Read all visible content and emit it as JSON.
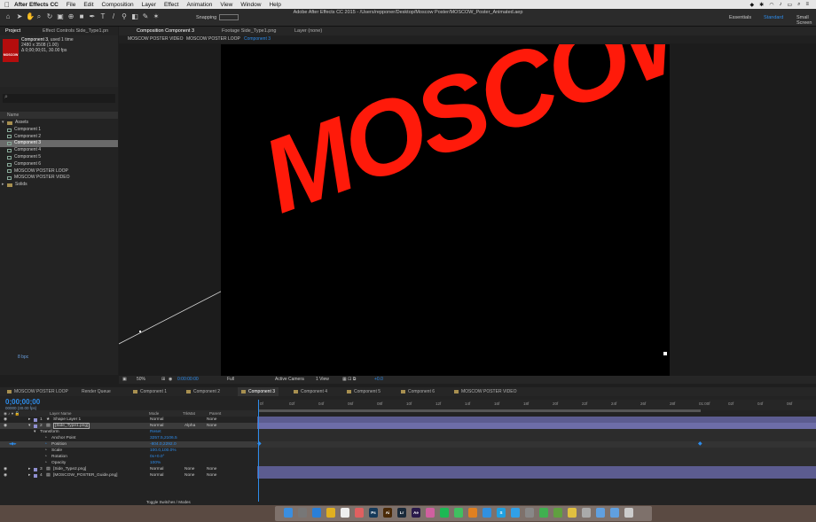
{
  "menubar": {
    "apple": "",
    "app": "After Effects CC",
    "items": [
      "File",
      "Edit",
      "Composition",
      "Layer",
      "Effect",
      "Animation",
      "View",
      "Window",
      "Help"
    ]
  },
  "window_title": "Adobe After Effects CC 2015 - /Users/repponer/Desktop/Moscow Poster/MOSCOW_Poster_Animated.aep",
  "toolbar": {
    "snapping": "Snapping",
    "workspaces": [
      "Essentials",
      "Standard",
      "Small Screen"
    ],
    "active_workspace": "Standard"
  },
  "project": {
    "tabs": [
      "Project",
      "Effect Controls Side_Type1.pn"
    ],
    "thumb_label": "MOSCOW",
    "selected_name": "Component 3",
    "used": ", used 1 time",
    "size": "2480 x 3508 (1.00)",
    "duration": "Δ 0;00;00;01, 30.00 fps",
    "search_icon": "⌕",
    "col_name": "Name",
    "items": [
      {
        "label": "Assets",
        "type": "folder"
      },
      {
        "label": "Component 1",
        "type": "comp"
      },
      {
        "label": "Component 2",
        "type": "comp"
      },
      {
        "label": "Component 3",
        "type": "comp"
      },
      {
        "label": "Component 4",
        "type": "comp"
      },
      {
        "label": "Component 5",
        "type": "comp"
      },
      {
        "label": "Component 6",
        "type": "comp"
      },
      {
        "label": "MOSCOW POSTER LOOP",
        "type": "comp"
      },
      {
        "label": "MOSCOW POSTER VIDEO",
        "type": "comp"
      },
      {
        "label": "Solids",
        "type": "folder"
      }
    ],
    "bpc": "8 bpc"
  },
  "composition": {
    "tabs": [
      "Composition Component 3",
      "Footage Side_Type1.png",
      "Layer (none)"
    ],
    "breadcrumbs": [
      "MOSCOW POSTER VIDEO",
      "MOSCOW POSTER LOOP",
      "Component 3"
    ],
    "canvas_text": "MOSCOW",
    "footer": {
      "zoom": "50%",
      "time": "0:00:00:00",
      "resolution": "Full",
      "camera": "Active Camera",
      "views": "1 View",
      "exposure": "+0.0"
    }
  },
  "timeline_tabs": [
    {
      "label": "MOSCOW POSTER LOOP",
      "color": "#a89050"
    },
    {
      "label": "Render Queue",
      "color": ""
    },
    {
      "label": "Component 1",
      "color": "#a89050"
    },
    {
      "label": "Component 2",
      "color": "#a89050"
    },
    {
      "label": "Component 3",
      "color": "#a89050",
      "active": true
    },
    {
      "label": "Component 4",
      "color": "#a89050"
    },
    {
      "label": "Component 5",
      "color": "#a89050"
    },
    {
      "label": "Component 6",
      "color": "#a89050"
    },
    {
      "label": "MOSCOW POSTER VIDEO",
      "color": "#a89050"
    }
  ],
  "timeline": {
    "timecode": "0;00;00;00",
    "fps": "00000 (30.00 fps)",
    "columns": {
      "layer_name": "Layer Name",
      "mode": "Mode",
      "trkmat": "TrkMat",
      "parent": "Parent"
    },
    "layers": [
      {
        "num": "1",
        "name": "Shape Layer 1",
        "mode": "Normal",
        "trkmat": "",
        "parent": "None",
        "color": "#8f8fd0"
      },
      {
        "num": "2",
        "name": "[Side_Type1.png]",
        "mode": "Normal",
        "trkmat": "Alpha",
        "parent": "None",
        "color": "#8f8fd0",
        "selected": true
      }
    ],
    "transform": {
      "label": "Transform",
      "reset": "Reset",
      "props": [
        {
          "name": "Anchor Point",
          "value": "3257.5,2106.5"
        },
        {
          "name": "Position",
          "value": "-804.0,2292.0"
        },
        {
          "name": "Scale",
          "value": "100.0,100.0%"
        },
        {
          "name": "Rotation",
          "value": "0x+0.0°"
        },
        {
          "name": "Opacity",
          "value": "100%"
        }
      ]
    },
    "more_layers": [
      {
        "num": "3",
        "name": "[Side_Type2.png]",
        "mode": "Normal",
        "trkmat": "None",
        "parent": "None",
        "color": "#8f8fd0"
      },
      {
        "num": "4",
        "name": "[MOSCOW_POSTER_Guide.png]",
        "mode": "Normal",
        "trkmat": "None",
        "parent": "None",
        "color": "#8f8fd0"
      }
    ],
    "ruler_ticks": [
      "0f",
      "02f",
      "04f",
      "06f",
      "08f",
      "10f",
      "12f",
      "14f",
      "16f",
      "18f",
      "20f",
      "22f",
      "24f",
      "26f",
      "28f",
      "01:00f",
      "02f",
      "04f",
      "06f"
    ],
    "toggle": "Toggle Switches / Modes"
  },
  "dock": {
    "apps": [
      {
        "name": "finder-icon",
        "color": "#3a8ee0",
        "glyph": ""
      },
      {
        "name": "launchpad-icon",
        "color": "#777",
        "glyph": ""
      },
      {
        "name": "safari-icon",
        "color": "#2a7fd8",
        "glyph": ""
      },
      {
        "name": "chrome-icon",
        "color": "#e0b020",
        "glyph": ""
      },
      {
        "name": "calendar-icon",
        "color": "#eee",
        "glyph": ""
      },
      {
        "name": "photos-icon",
        "color": "#e06060",
        "glyph": ""
      },
      {
        "name": "photoshop-icon",
        "color": "#163a5a",
        "glyph": "Ps"
      },
      {
        "name": "illustrator-icon",
        "color": "#4a2a08",
        "glyph": "Ai"
      },
      {
        "name": "lightroom-icon",
        "color": "#1a2a3a",
        "glyph": "Lr"
      },
      {
        "name": "after-effects-icon",
        "color": "#2a1a4a",
        "glyph": "Ae"
      },
      {
        "name": "itunes-icon",
        "color": "#d060a0",
        "glyph": ""
      },
      {
        "name": "spotify-icon",
        "color": "#1db954",
        "glyph": ""
      },
      {
        "name": "messages-icon",
        "color": "#40c060",
        "glyph": ""
      },
      {
        "name": "vlc-icon",
        "color": "#e08020",
        "glyph": ""
      },
      {
        "name": "app-store-icon",
        "color": "#3090e0",
        "glyph": ""
      },
      {
        "name": "skype-icon",
        "color": "#20a0e0",
        "glyph": "S"
      },
      {
        "name": "twitter-icon",
        "color": "#30a0e8",
        "glyph": ""
      },
      {
        "name": "preferences-icon",
        "color": "#888",
        "glyph": ""
      },
      {
        "name": "facetime-icon",
        "color": "#40b050",
        "glyph": ""
      },
      {
        "name": "maps-icon",
        "color": "#60a040",
        "glyph": ""
      },
      {
        "name": "notes-icon",
        "color": "#e0c040",
        "glyph": ""
      },
      {
        "name": "font-book-icon",
        "color": "#aaa",
        "glyph": ""
      },
      {
        "name": "downloads-folder-icon",
        "color": "#60a0e0",
        "glyph": ""
      },
      {
        "name": "documents-folder-icon",
        "color": "#60a0e0",
        "glyph": ""
      },
      {
        "name": "trash-icon",
        "color": "#ccc",
        "glyph": ""
      }
    ]
  }
}
